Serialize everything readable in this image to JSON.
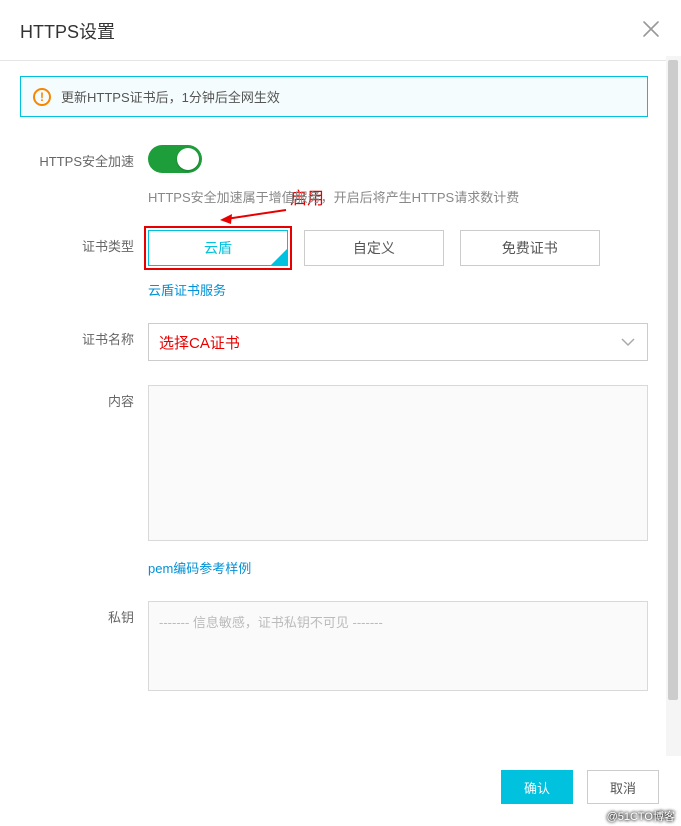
{
  "header": {
    "title": "HTTPS设置"
  },
  "alert": {
    "text": "更新HTTPS证书后，1分钟后全网生效"
  },
  "annotation": {
    "enable": "启用"
  },
  "rows": {
    "accel": {
      "label": "HTTPS安全加速",
      "desc": "HTTPS安全加速属于增值服务，开启后将产生HTTPS请求数计费"
    },
    "certType": {
      "label": "证书类型",
      "options": [
        "云盾",
        "自定义",
        "免费证书"
      ],
      "sublink": "云盾证书服务"
    },
    "certName": {
      "label": "证书名称",
      "placeholder": "选择CA证书"
    },
    "content": {
      "label": "内容",
      "sublink": "pem编码参考样例"
    },
    "privKey": {
      "label": "私钥",
      "placeholder": "------- 信息敏感，证书私钥不可见 -------"
    }
  },
  "footer": {
    "confirm": "确认",
    "cancel": "取消"
  },
  "watermark": "@51CTO博客"
}
